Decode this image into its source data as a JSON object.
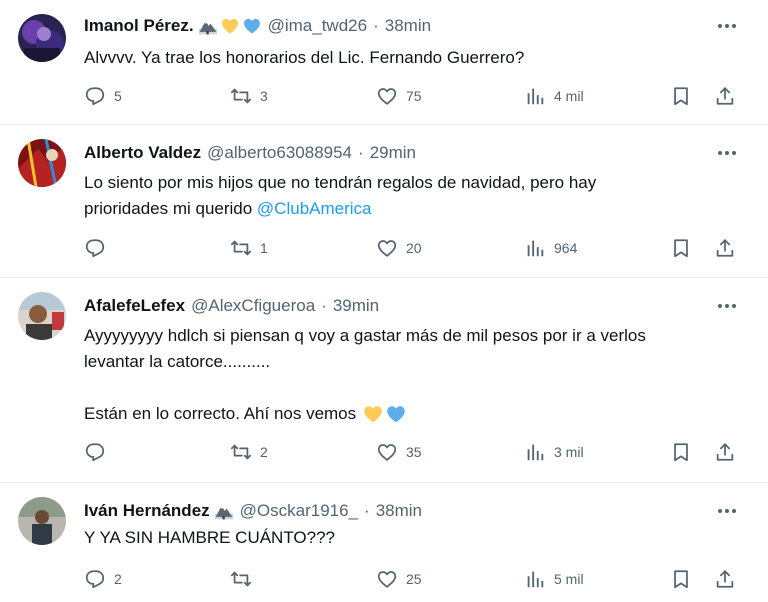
{
  "tweets": [
    {
      "name": "Imanol Pérez.",
      "handle": "@ima_twd26",
      "separator": "·",
      "time": "38min",
      "badges": [
        "mountain-emoji",
        "yellow-heart",
        "blue-heart"
      ],
      "text": "Alvvvv. Ya trae los honorarios del Lic. Fernando Guerrero?",
      "replies": "5",
      "retweets": "3",
      "likes": "75",
      "views": "4 mil"
    },
    {
      "name": "Alberto Valdez",
      "handle": "@alberto63088954",
      "separator": "·",
      "time": "29min",
      "text_line1": "Lo siento por mis hijos que no tendrán regalos de navidad, pero hay",
      "text_line2": "prioridades mi querido ",
      "mention": "@ClubAmerica",
      "replies": "",
      "retweets": "1",
      "likes": "20",
      "views": "964"
    },
    {
      "name": "AfalefeLefex",
      "handle": "@AlexCfigueroa",
      "separator": "·",
      "time": "39min",
      "text_line1": "Ayyyyyyyy hdlch si piensan q voy a gastar más de mil pesos por ir a verlos",
      "text_line2": "levantar la catorce..........",
      "text_line3": "Están en lo correcto. Ahí nos vemos",
      "badges": [
        "yellow-heart",
        "blue-heart"
      ],
      "replies": "",
      "retweets": "2",
      "likes": "35",
      "views": "3 mil"
    },
    {
      "name": "Iván Hernández",
      "handle": "@Osckar1916_",
      "separator": "·",
      "time": "38min",
      "badges": [
        "mountain-emoji"
      ],
      "text": "Y YA SIN HAMBRE CUÁNTO???",
      "replies": "2",
      "retweets": "",
      "likes": "25",
      "views": "5 mil"
    }
  ],
  "colors": {
    "text": "#0f1419",
    "secondary": "#536471",
    "link": "#1d9bf0",
    "divider": "#e6ecf0",
    "yellow_heart": "#fdcb58",
    "blue_heart": "#5dadec"
  }
}
